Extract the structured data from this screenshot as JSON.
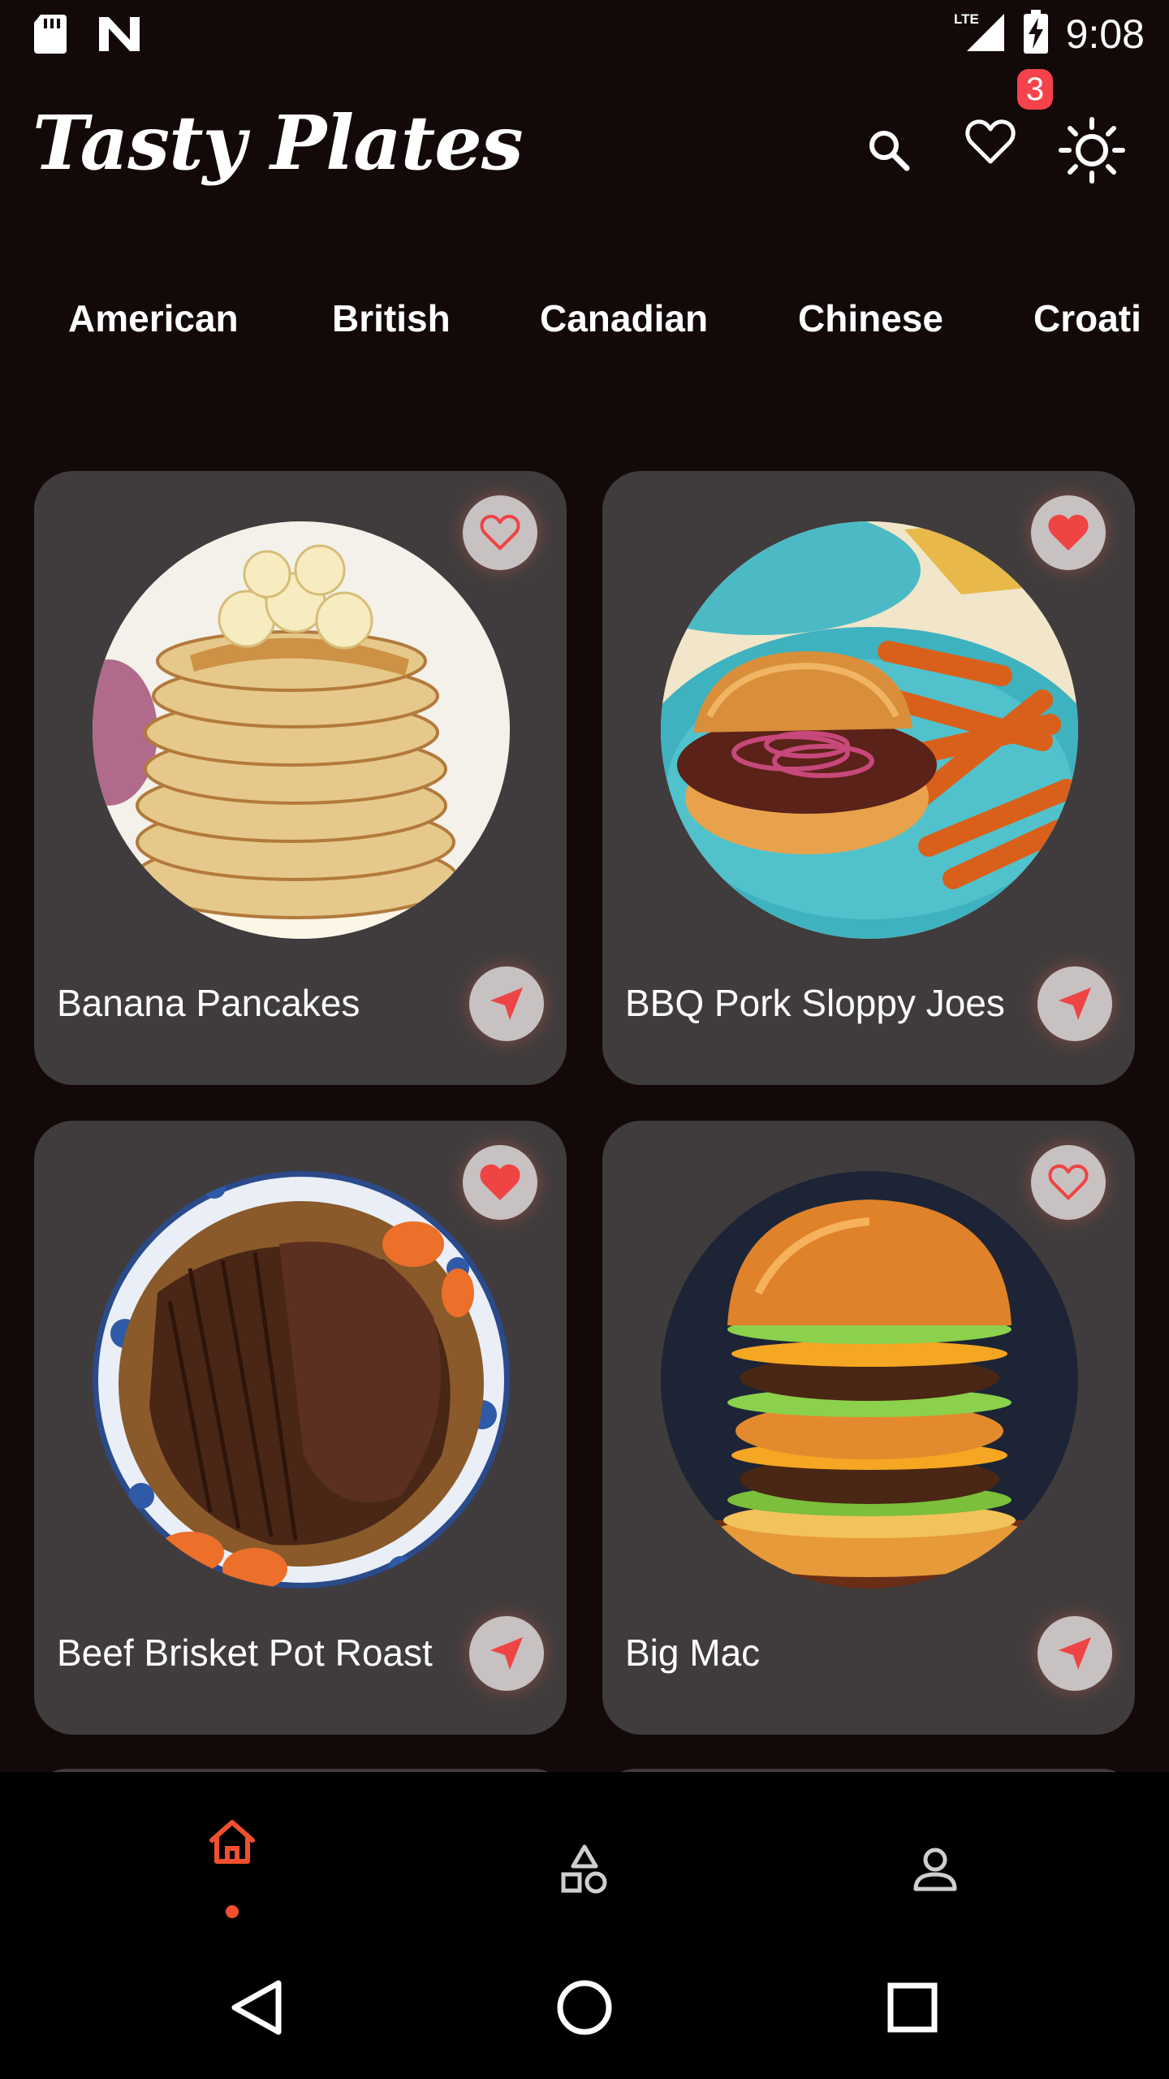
{
  "status_bar": {
    "time": "9:08",
    "network": "LTE",
    "icons": [
      "sd-card-icon",
      "n-notification-icon",
      "signal-icon",
      "battery-charging-icon"
    ]
  },
  "app": {
    "title": "Tasty Plates",
    "favorites_count": "3",
    "actions": [
      "search-icon",
      "heart-icon",
      "sun-icon"
    ]
  },
  "categories": [
    "American",
    "British",
    "Canadian",
    "Chinese",
    "Croati"
  ],
  "recipes": [
    {
      "title": "Banana Pancakes",
      "favorite": false,
      "image": "pancake-stack-photo"
    },
    {
      "title": "BBQ Pork Sloppy Joes",
      "favorite": true,
      "image": "sloppy-joe-and-fries-photo"
    },
    {
      "title": "Beef Brisket Pot Roast",
      "favorite": true,
      "image": "beef-brisket-photo"
    },
    {
      "title": "Big Mac",
      "favorite": false,
      "image": "double-burger-photo"
    }
  ],
  "bottom_nav": {
    "items": [
      "home-icon",
      "shapes-icon",
      "profile-icon"
    ],
    "active": "home-icon",
    "active_color": "#f0502e"
  },
  "system_nav": [
    "back-icon",
    "home-circle-icon",
    "recents-icon"
  ],
  "colors": {
    "background": "#130909",
    "card": "#403c3d",
    "button": "#c7c1c2",
    "accent": "#f4434b"
  }
}
